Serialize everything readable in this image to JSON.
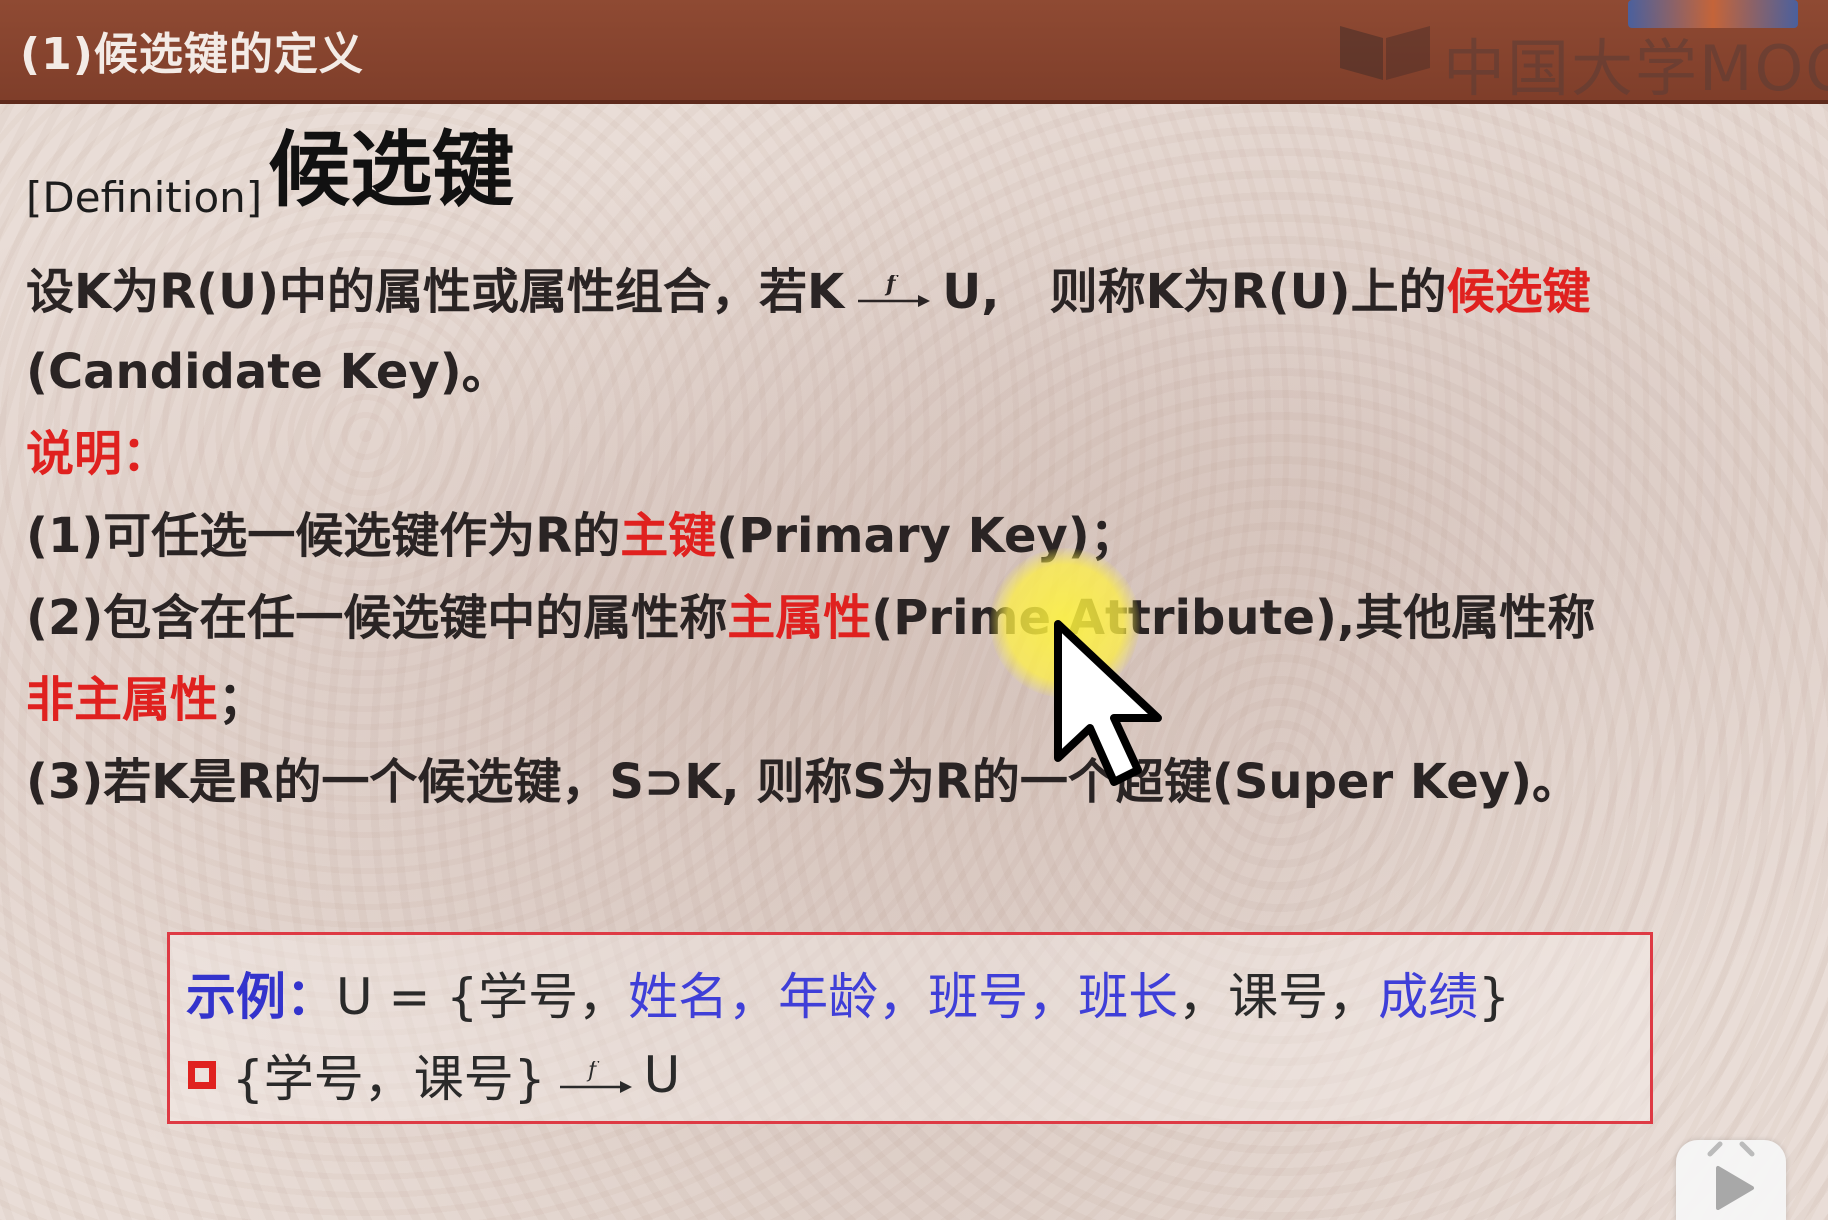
{
  "header": {
    "title": "(1)候选键的定义",
    "brand_text": "中国大学MOOC"
  },
  "definition": {
    "tag": "[Definition]",
    "title": "候选键"
  },
  "body": {
    "line1_pre": "设K为R(U)中的属性或属性组合，若K",
    "arrow_label": "f",
    "line1_mid": "U,   则称K为R(U)上的",
    "line1_red": "候选键",
    "line2": "(Candidate Key)。",
    "note_label": "说明：",
    "item1_pre": "(1)可任选一候选键作为R的",
    "item1_red": "主键",
    "item1_post": "(Primary Key)；",
    "item2_pre": "(2)包含在任一候选键中的属性称",
    "item2_red": "主属性",
    "item2_post": "(Prime Attribute),其他属性称",
    "item2b_red": "非主属性",
    "item2b_post": "；",
    "item3": "(3)若K是R的一个候选键，S⊃K, 则称S为R的一个超键(Super Key)。"
  },
  "example": {
    "label": "示例：",
    "u_open": "U = {",
    "attrs": [
      {
        "text": "学号",
        "color": "#2a2a2a"
      },
      {
        "text": "姓名",
        "color": "#3f3fd8"
      },
      {
        "text": "年龄",
        "color": "#3f3fd8"
      },
      {
        "text": "班号",
        "color": "#3f3fd8"
      },
      {
        "text": "班长",
        "color": "#3f3fd8"
      },
      {
        "text": "课号",
        "color": "#2a2a2a"
      },
      {
        "text": "成绩",
        "color": "#3f3fd8"
      }
    ],
    "separator": "，",
    "u_close": "}",
    "fd_lhs": "{学号，课号}",
    "fd_arrow_label": "f",
    "fd_rhs": "U"
  },
  "colors": {
    "header_bg": "#8f4a33",
    "accent_red": "#e0211f",
    "example_blue": "#3f3fd8",
    "box_border": "#de3a44"
  },
  "icons": [
    "video-play-icon",
    "mouse-cursor-icon",
    "mooc-logo-icon"
  ]
}
